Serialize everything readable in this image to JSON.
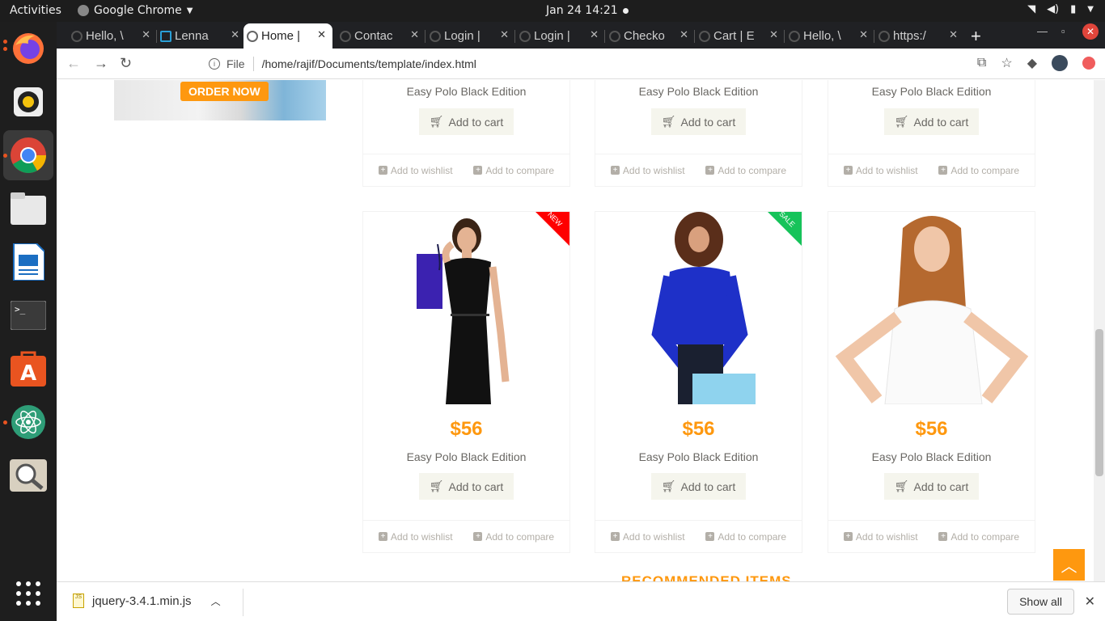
{
  "system": {
    "activities": "Activities",
    "app_name": "Google Chrome",
    "clock": "Jan 24  14:21"
  },
  "tabs": [
    {
      "label": "Hello, \\",
      "active": false
    },
    {
      "label": "Lenna",
      "active": false
    },
    {
      "label": "Home |",
      "active": true
    },
    {
      "label": "Contac",
      "active": false
    },
    {
      "label": "Login |",
      "active": false
    },
    {
      "label": "Login |",
      "active": false
    },
    {
      "label": "Checko",
      "active": false
    },
    {
      "label": "Cart | E",
      "active": false
    },
    {
      "label": "Hello, \\",
      "active": false
    },
    {
      "label": "https:/",
      "active": false
    }
  ],
  "toolbar": {
    "file_label": "File",
    "url": "/home/rajif/Documents/template/index.html"
  },
  "banner": {
    "order_now": "ORDER NOW"
  },
  "products_top": [
    {
      "name": "Easy Polo Black Edition",
      "cart": "Add to cart",
      "wishlist": "Add to wishlist",
      "compare": "Add to compare"
    },
    {
      "name": "Easy Polo Black Edition",
      "cart": "Add to cart",
      "wishlist": "Add to wishlist",
      "compare": "Add to compare"
    },
    {
      "name": "Easy Polo Black Edition",
      "cart": "Add to cart",
      "wishlist": "Add to wishlist",
      "compare": "Add to compare"
    }
  ],
  "products": [
    {
      "price": "$56",
      "name": "Easy Polo Black Edition",
      "cart": "Add to cart",
      "wishlist": "Add to wishlist",
      "compare": "Add to compare",
      "ribbon": "NEW"
    },
    {
      "price": "$56",
      "name": "Easy Polo Black Edition",
      "cart": "Add to cart",
      "wishlist": "Add to wishlist",
      "compare": "Add to compare",
      "ribbon": "SALE"
    },
    {
      "price": "$56",
      "name": "Easy Polo Black Edition",
      "cart": "Add to cart",
      "wishlist": "Add to wishlist",
      "compare": "Add to compare",
      "ribbon": ""
    }
  ],
  "section_heading": "RECOMMENDED ITEMS",
  "download": {
    "filename": "jquery-3.4.1.min.js",
    "show_all": "Show all"
  },
  "colors": {
    "accent": "#fe980f",
    "new_ribbon": "#fe0000",
    "sale_ribbon": "#16c35a"
  }
}
